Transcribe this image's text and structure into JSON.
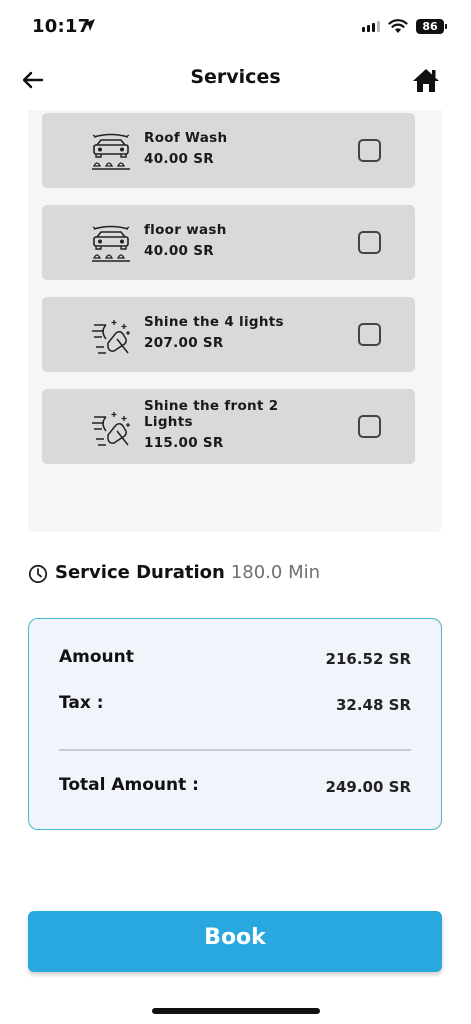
{
  "status_bar": {
    "time": "10:17",
    "battery": "86"
  },
  "nav": {
    "title": "Services",
    "back_icon": "arrow-left-icon",
    "home_icon": "home-icon"
  },
  "services": [
    {
      "name": "Roof Wash",
      "price": "40.00 SR",
      "icon": "car-wash-icon",
      "checked": false
    },
    {
      "name": "floor wash",
      "price": "40.00 SR",
      "icon": "car-wash-icon",
      "checked": false
    },
    {
      "name": "Shine the 4 lights",
      "price": "207.00 SR",
      "icon": "headlight-polish-icon",
      "checked": false
    },
    {
      "name": "Shine the front 2 Lights",
      "price": "115.00 SR",
      "icon": "headlight-polish-icon",
      "checked": false
    }
  ],
  "duration": {
    "label": "Service Duration",
    "value": "180.0 Min"
  },
  "totals": {
    "amount_label": "Amount",
    "amount_value": "216.52 SR",
    "tax_label": "Tax :",
    "tax_value": "32.48 SR",
    "total_label": "Total Amount :",
    "total_value": "249.00 SR"
  },
  "book_button": {
    "label": "Book"
  },
  "colors": {
    "accent": "#29a8e0",
    "card_border": "#48b6c9",
    "card_bg": "#f1f5fb",
    "service_card_bg": "#d9d9d9"
  }
}
